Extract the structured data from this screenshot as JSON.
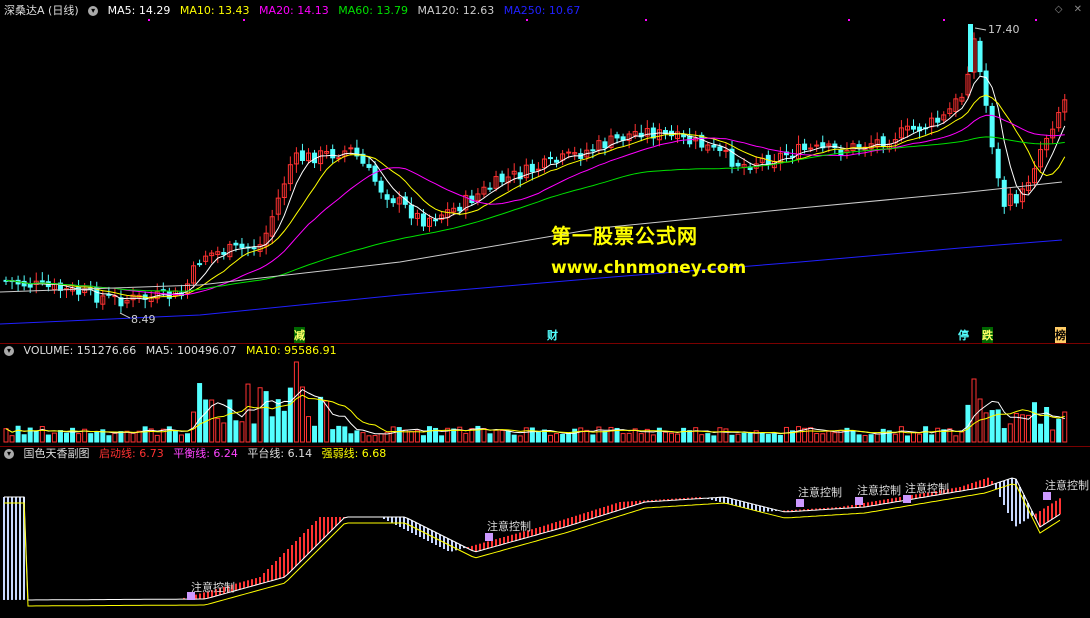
{
  "main_header": {
    "title": "深桑达A (日线)",
    "ma5": "MA5: 14.29",
    "ma10": "MA10: 13.43",
    "ma20": "MA20: 14.13",
    "ma60": "MA60: 13.79",
    "ma120": "MA120: 12.63",
    "ma250": "MA250: 10.67"
  },
  "price_labels": {
    "high": "17.40",
    "low": "8.49"
  },
  "watermark": {
    "line1": "第一股票公式网",
    "line2": "www.chnmoney.com"
  },
  "event_tags": [
    "减",
    "财",
    "停",
    "跌",
    "榜"
  ],
  "volume_header": {
    "volume": "VOLUME: 151276.66",
    "ma5": "MA5: 100496.07",
    "ma10": "MA10: 95586.91"
  },
  "indicator_header": {
    "name": "国色天香副图",
    "start": "启动线: 6.73",
    "balance": "平衡线: 6.24",
    "platform": "平台线: 6.14",
    "strong": "强弱线: 6.68"
  },
  "indicator_notes": [
    "注意控制",
    "注意控制",
    "注意控制",
    "注意控制",
    "注意控制",
    "注意控制"
  ],
  "colors": {
    "up": "#ff3232",
    "down": "#54ffff",
    "ma5": "#ffffff",
    "ma10": "#ffff00",
    "ma20": "#ff00ff",
    "ma60": "#00e000",
    "ma120": "#cccccc",
    "ma250": "#2020ff",
    "bg": "#000000",
    "grid": "#7a0000"
  }
}
